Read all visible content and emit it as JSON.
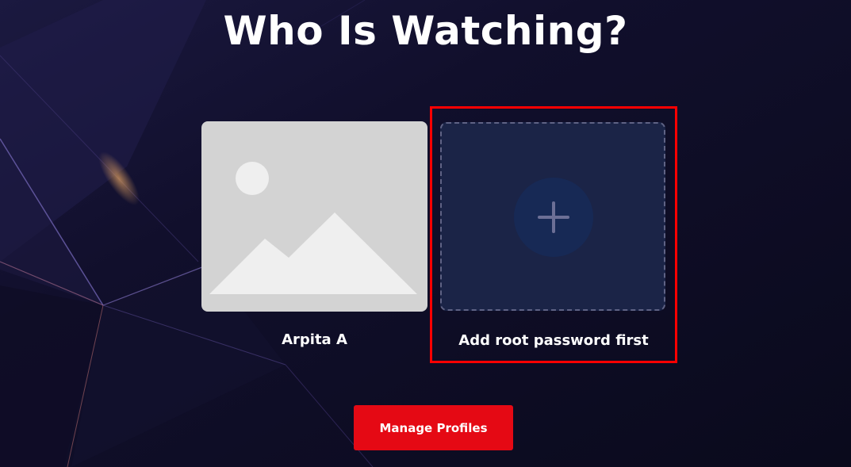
{
  "page": {
    "title": "Who Is Watching?"
  },
  "profiles": [
    {
      "name": "Arpita A",
      "avatar_icon": "image-placeholder-icon"
    }
  ],
  "add_profile": {
    "label": "Add root password first",
    "icon": "plus-icon"
  },
  "actions": {
    "manage_label": "Manage Profiles"
  },
  "colors": {
    "background": "#0d0c23",
    "accent": "#e50914",
    "highlight_border": "#ff0000",
    "add_card_bg": "#1b2447",
    "placeholder_bg": "#d3d3d3"
  }
}
